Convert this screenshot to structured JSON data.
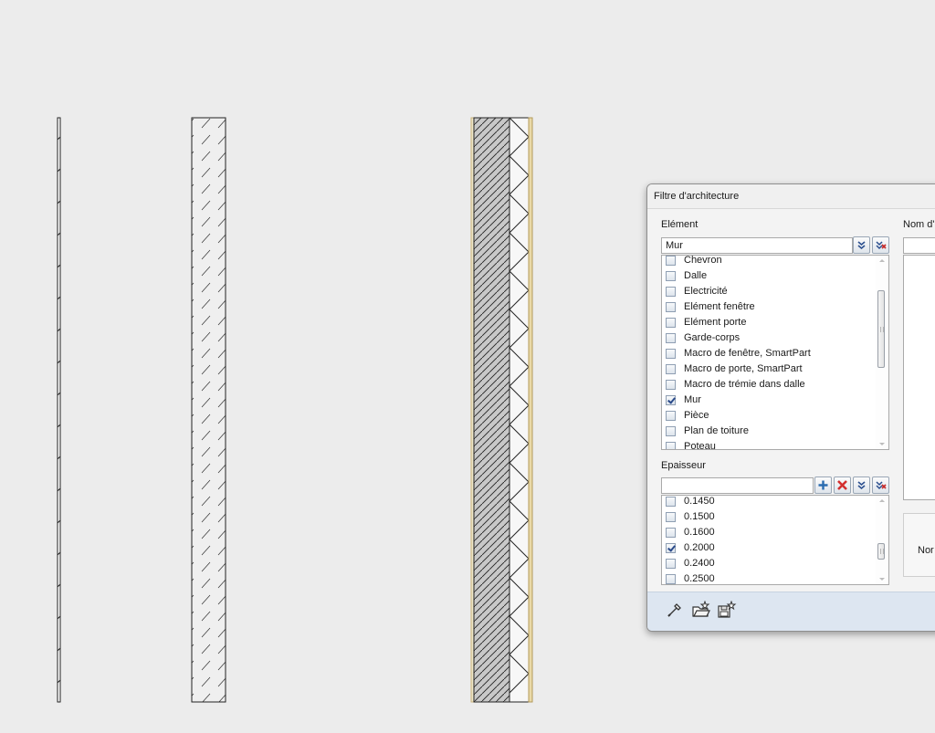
{
  "dialog": {
    "title": "Filtre d'architecture",
    "element_section": {
      "label": "Elément",
      "combo_value": "Mur",
      "items": [
        {
          "label": "Chevron",
          "checked": false
        },
        {
          "label": "Dalle",
          "checked": false
        },
        {
          "label": "Electricité",
          "checked": false
        },
        {
          "label": "Elément fenêtre",
          "checked": false
        },
        {
          "label": "Elément porte",
          "checked": false
        },
        {
          "label": "Garde-corps",
          "checked": false
        },
        {
          "label": "Macro de fenêtre, SmartPart",
          "checked": false
        },
        {
          "label": "Macro de porte, SmartPart",
          "checked": false
        },
        {
          "label": "Macro de trémie dans dalle",
          "checked": false
        },
        {
          "label": "Mur",
          "checked": true
        },
        {
          "label": "Pièce",
          "checked": false
        },
        {
          "label": "Plan de toiture",
          "checked": false
        },
        {
          "label": "Poteau",
          "checked": false
        }
      ]
    },
    "thickness_section": {
      "label": "Epaisseur",
      "combo_value": "",
      "items": [
        {
          "label": "0.1450",
          "checked": false
        },
        {
          "label": "0.1500",
          "checked": false
        },
        {
          "label": "0.1600",
          "checked": false
        },
        {
          "label": "0.2000",
          "checked": true
        },
        {
          "label": "0.2400",
          "checked": false
        },
        {
          "label": "0.2500",
          "checked": false
        }
      ]
    },
    "name_section": {
      "label": "Nom d'",
      "name_label": "Nor"
    },
    "icons": {
      "select_all": "double-chevron-check-icon",
      "deselect_all": "double-chevron-cross-icon",
      "add": "plus-icon",
      "delete": "red-x-icon",
      "pick": "eyedropper-icon",
      "open": "folder-star-icon",
      "save": "save-star-icon"
    }
  },
  "colors": {
    "background": "#ececec",
    "hatch_fill": "#c8c8c8",
    "insulation_line": "#c7b27c",
    "bottom_bar": "#dde6f1"
  }
}
